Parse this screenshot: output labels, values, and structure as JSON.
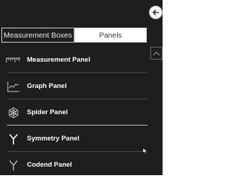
{
  "tabs": [
    {
      "label": "Measurement Boxes",
      "active": false
    },
    {
      "label": "Panels",
      "active": true
    }
  ],
  "items": [
    {
      "label": "Measurement Panel",
      "icon": "ruler-icon"
    },
    {
      "label": "Graph Panel",
      "icon": "graph-icon"
    },
    {
      "label": "Spider Panel",
      "icon": "spider-icon"
    },
    {
      "label": "Symmetry Panel",
      "icon": "symmetry-icon"
    },
    {
      "label": "Codend Panel",
      "icon": "codend-icon"
    }
  ],
  "colors": {
    "panel_bg": "#1e1e1e",
    "tab_active_bg": "#ffffff",
    "text": "#ffffff"
  }
}
